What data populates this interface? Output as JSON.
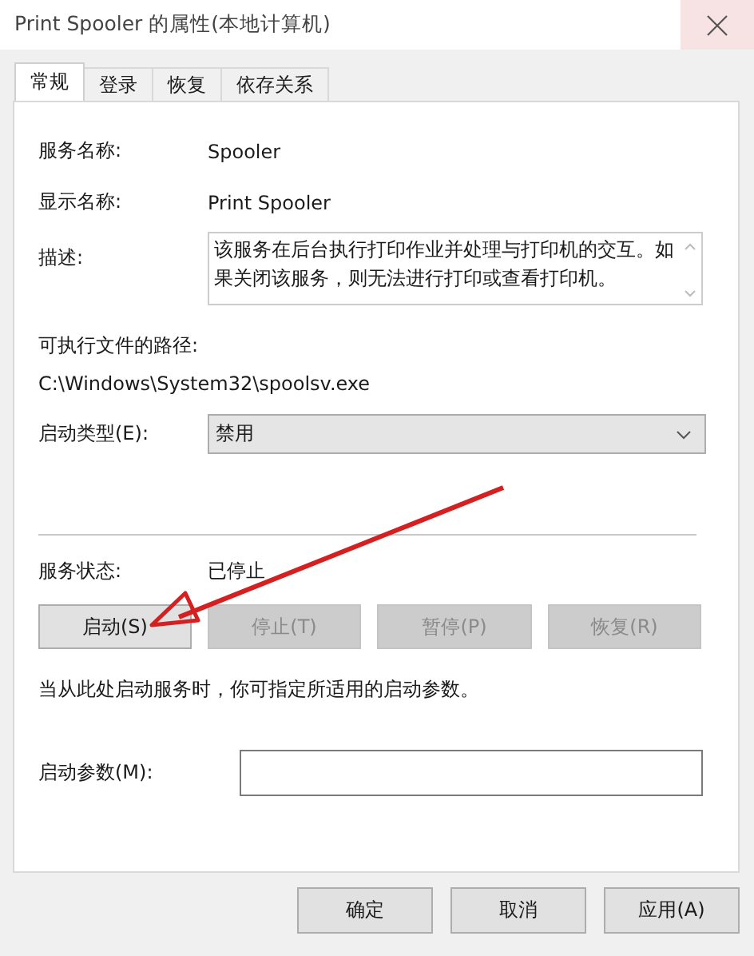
{
  "window": {
    "title": "Print Spooler 的属性(本地计算机)"
  },
  "tabs": [
    {
      "label": "常规",
      "selected": true
    },
    {
      "label": "登录",
      "selected": false
    },
    {
      "label": "恢复",
      "selected": false
    },
    {
      "label": "依存关系",
      "selected": false
    }
  ],
  "service_name": {
    "label": "服务名称:",
    "value": "Spooler"
  },
  "display_name": {
    "label": "显示名称:",
    "value": "Print Spooler"
  },
  "description": {
    "label": "描述:",
    "value": "该服务在后台执行打印作业并处理与打印机的交互。如果关闭该服务，则无法进行打印或查看打印机。"
  },
  "executable_path": {
    "label": "可执行文件的路径:",
    "value": "C:\\Windows\\System32\\spoolsv.exe"
  },
  "startup_type": {
    "label": "启动类型(E):",
    "value": "禁用"
  },
  "service_status": {
    "label": "服务状态:",
    "value": "已停止"
  },
  "service_buttons": [
    {
      "label": "启动(S)",
      "disabled": false
    },
    {
      "label": "停止(T)",
      "disabled": true
    },
    {
      "label": "暂停(P)",
      "disabled": true
    },
    {
      "label": "恢复(R)",
      "disabled": true
    }
  ],
  "hint": "当从此处启动服务时，你可指定所适用的启动参数。",
  "start_parameters": {
    "label": "启动参数(M):"
  },
  "dialog_buttons": [
    "确定",
    "取消",
    "应用(A)"
  ]
}
